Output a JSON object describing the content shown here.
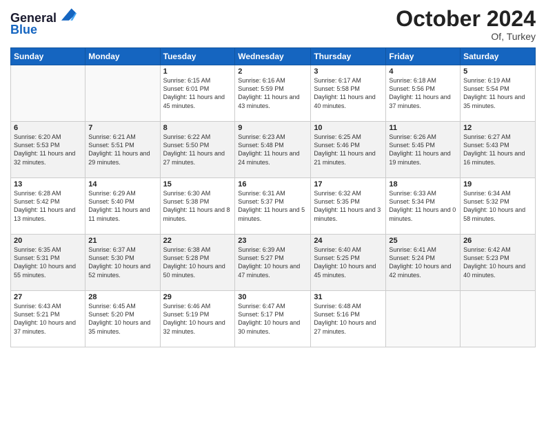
{
  "header": {
    "logo_line1": "General",
    "logo_line2": "Blue",
    "month": "October 2024",
    "location": "Of, Turkey"
  },
  "weekdays": [
    "Sunday",
    "Monday",
    "Tuesday",
    "Wednesday",
    "Thursday",
    "Friday",
    "Saturday"
  ],
  "weeks": [
    [
      {
        "day": "",
        "sunrise": "",
        "sunset": "",
        "daylight": ""
      },
      {
        "day": "",
        "sunrise": "",
        "sunset": "",
        "daylight": ""
      },
      {
        "day": "1",
        "sunrise": "Sunrise: 6:15 AM",
        "sunset": "Sunset: 6:01 PM",
        "daylight": "Daylight: 11 hours and 45 minutes."
      },
      {
        "day": "2",
        "sunrise": "Sunrise: 6:16 AM",
        "sunset": "Sunset: 5:59 PM",
        "daylight": "Daylight: 11 hours and 43 minutes."
      },
      {
        "day": "3",
        "sunrise": "Sunrise: 6:17 AM",
        "sunset": "Sunset: 5:58 PM",
        "daylight": "Daylight: 11 hours and 40 minutes."
      },
      {
        "day": "4",
        "sunrise": "Sunrise: 6:18 AM",
        "sunset": "Sunset: 5:56 PM",
        "daylight": "Daylight: 11 hours and 37 minutes."
      },
      {
        "day": "5",
        "sunrise": "Sunrise: 6:19 AM",
        "sunset": "Sunset: 5:54 PM",
        "daylight": "Daylight: 11 hours and 35 minutes."
      }
    ],
    [
      {
        "day": "6",
        "sunrise": "Sunrise: 6:20 AM",
        "sunset": "Sunset: 5:53 PM",
        "daylight": "Daylight: 11 hours and 32 minutes."
      },
      {
        "day": "7",
        "sunrise": "Sunrise: 6:21 AM",
        "sunset": "Sunset: 5:51 PM",
        "daylight": "Daylight: 11 hours and 29 minutes."
      },
      {
        "day": "8",
        "sunrise": "Sunrise: 6:22 AM",
        "sunset": "Sunset: 5:50 PM",
        "daylight": "Daylight: 11 hours and 27 minutes."
      },
      {
        "day": "9",
        "sunrise": "Sunrise: 6:23 AM",
        "sunset": "Sunset: 5:48 PM",
        "daylight": "Daylight: 11 hours and 24 minutes."
      },
      {
        "day": "10",
        "sunrise": "Sunrise: 6:25 AM",
        "sunset": "Sunset: 5:46 PM",
        "daylight": "Daylight: 11 hours and 21 minutes."
      },
      {
        "day": "11",
        "sunrise": "Sunrise: 6:26 AM",
        "sunset": "Sunset: 5:45 PM",
        "daylight": "Daylight: 11 hours and 19 minutes."
      },
      {
        "day": "12",
        "sunrise": "Sunrise: 6:27 AM",
        "sunset": "Sunset: 5:43 PM",
        "daylight": "Daylight: 11 hours and 16 minutes."
      }
    ],
    [
      {
        "day": "13",
        "sunrise": "Sunrise: 6:28 AM",
        "sunset": "Sunset: 5:42 PM",
        "daylight": "Daylight: 11 hours and 13 minutes."
      },
      {
        "day": "14",
        "sunrise": "Sunrise: 6:29 AM",
        "sunset": "Sunset: 5:40 PM",
        "daylight": "Daylight: 11 hours and 11 minutes."
      },
      {
        "day": "15",
        "sunrise": "Sunrise: 6:30 AM",
        "sunset": "Sunset: 5:38 PM",
        "daylight": "Daylight: 11 hours and 8 minutes."
      },
      {
        "day": "16",
        "sunrise": "Sunrise: 6:31 AM",
        "sunset": "Sunset: 5:37 PM",
        "daylight": "Daylight: 11 hours and 5 minutes."
      },
      {
        "day": "17",
        "sunrise": "Sunrise: 6:32 AM",
        "sunset": "Sunset: 5:35 PM",
        "daylight": "Daylight: 11 hours and 3 minutes."
      },
      {
        "day": "18",
        "sunrise": "Sunrise: 6:33 AM",
        "sunset": "Sunset: 5:34 PM",
        "daylight": "Daylight: 11 hours and 0 minutes."
      },
      {
        "day": "19",
        "sunrise": "Sunrise: 6:34 AM",
        "sunset": "Sunset: 5:32 PM",
        "daylight": "Daylight: 10 hours and 58 minutes."
      }
    ],
    [
      {
        "day": "20",
        "sunrise": "Sunrise: 6:35 AM",
        "sunset": "Sunset: 5:31 PM",
        "daylight": "Daylight: 10 hours and 55 minutes."
      },
      {
        "day": "21",
        "sunrise": "Sunrise: 6:37 AM",
        "sunset": "Sunset: 5:30 PM",
        "daylight": "Daylight: 10 hours and 52 minutes."
      },
      {
        "day": "22",
        "sunrise": "Sunrise: 6:38 AM",
        "sunset": "Sunset: 5:28 PM",
        "daylight": "Daylight: 10 hours and 50 minutes."
      },
      {
        "day": "23",
        "sunrise": "Sunrise: 6:39 AM",
        "sunset": "Sunset: 5:27 PM",
        "daylight": "Daylight: 10 hours and 47 minutes."
      },
      {
        "day": "24",
        "sunrise": "Sunrise: 6:40 AM",
        "sunset": "Sunset: 5:25 PM",
        "daylight": "Daylight: 10 hours and 45 minutes."
      },
      {
        "day": "25",
        "sunrise": "Sunrise: 6:41 AM",
        "sunset": "Sunset: 5:24 PM",
        "daylight": "Daylight: 10 hours and 42 minutes."
      },
      {
        "day": "26",
        "sunrise": "Sunrise: 6:42 AM",
        "sunset": "Sunset: 5:23 PM",
        "daylight": "Daylight: 10 hours and 40 minutes."
      }
    ],
    [
      {
        "day": "27",
        "sunrise": "Sunrise: 6:43 AM",
        "sunset": "Sunset: 5:21 PM",
        "daylight": "Daylight: 10 hours and 37 minutes."
      },
      {
        "day": "28",
        "sunrise": "Sunrise: 6:45 AM",
        "sunset": "Sunset: 5:20 PM",
        "daylight": "Daylight: 10 hours and 35 minutes."
      },
      {
        "day": "29",
        "sunrise": "Sunrise: 6:46 AM",
        "sunset": "Sunset: 5:19 PM",
        "daylight": "Daylight: 10 hours and 32 minutes."
      },
      {
        "day": "30",
        "sunrise": "Sunrise: 6:47 AM",
        "sunset": "Sunset: 5:17 PM",
        "daylight": "Daylight: 10 hours and 30 minutes."
      },
      {
        "day": "31",
        "sunrise": "Sunrise: 6:48 AM",
        "sunset": "Sunset: 5:16 PM",
        "daylight": "Daylight: 10 hours and 27 minutes."
      },
      {
        "day": "",
        "sunrise": "",
        "sunset": "",
        "daylight": ""
      },
      {
        "day": "",
        "sunrise": "",
        "sunset": "",
        "daylight": ""
      }
    ]
  ]
}
